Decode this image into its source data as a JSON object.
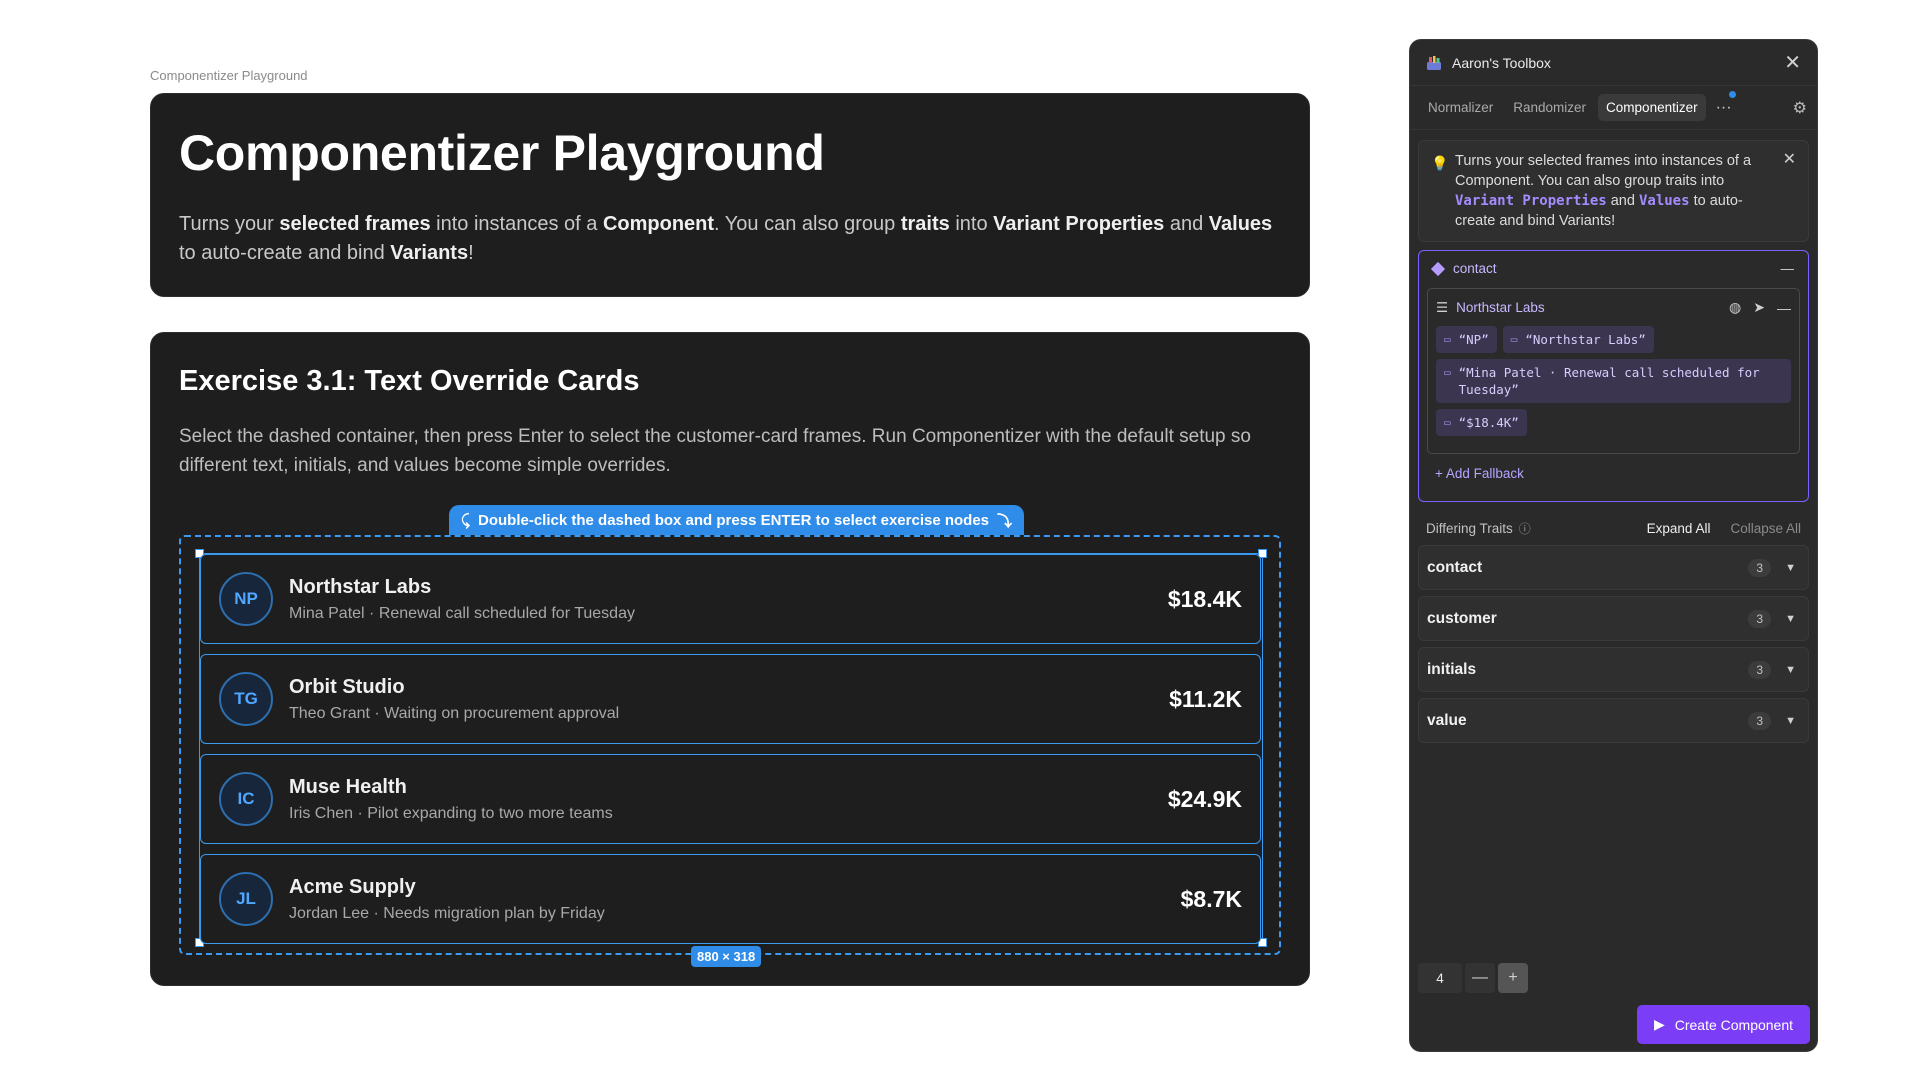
{
  "canvas": {
    "label": "Componentizer Playground"
  },
  "hero": {
    "title": "Componentizer Playground",
    "desc_1": "Turns your ",
    "desc_b1": "selected frames",
    "desc_2": " into instances of a ",
    "desc_b2": "Component",
    "desc_3": ". You can also group ",
    "desc_b3": "traits",
    "desc_4": " into ",
    "desc_b4": "Variant Properties",
    "desc_5": " and ",
    "desc_b5": "Values",
    "desc_6": " to auto-create and bind ",
    "desc_b6": "Variants",
    "desc_7": "!"
  },
  "exercise": {
    "title": "Exercise 3.1: Text Override Cards",
    "description": "Select the dashed container, then press Enter to select the customer-card frames. Run Componentizer with the default setup so different text, initials, and values become simple overrides.",
    "hint": "Double-click the dashed box and press ENTER to select exercise nodes",
    "dimensions": "880 × 318",
    "cards": [
      {
        "initials": "NP",
        "name": "Northstar Labs",
        "sub": "Mina Patel · Renewal call scheduled for Tuesday",
        "value": "$18.4K"
      },
      {
        "initials": "TG",
        "name": "Orbit Studio",
        "sub": "Theo Grant · Waiting on procurement approval",
        "value": "$11.2K"
      },
      {
        "initials": "IC",
        "name": "Muse Health",
        "sub": "Iris Chen · Pilot expanding to two more teams",
        "value": "$24.9K"
      },
      {
        "initials": "JL",
        "name": "Acme Supply",
        "sub": "Jordan Lee · Needs migration plan by Friday",
        "value": "$8.7K"
      }
    ]
  },
  "panel": {
    "title": "Aaron's Toolbox",
    "tabs": [
      "Normalizer",
      "Randomizer",
      "Componentizer"
    ],
    "active_tab": "Componentizer",
    "more": "···",
    "info": {
      "t1": "Turns your selected frames into instances of a Component. You can also group traits into ",
      "code1": "Variant Properties",
      "t2": " and ",
      "code2": "Values",
      "t3": " to auto-create and bind Variants!"
    },
    "group": {
      "name": "contact",
      "sub_name": "Northstar Labs",
      "chips": [
        "“NP”",
        "“Northstar Labs”",
        "“Mina Patel · Renewal call scheduled for Tuesday”",
        "“$18.4K”"
      ],
      "add_fallback": "+ Add Fallback"
    },
    "traits": {
      "label": "Differing Traits",
      "expand_all": "Expand All",
      "collapse_all": "Collapse All",
      "items": [
        {
          "name": "contact",
          "count": "3"
        },
        {
          "name": "customer",
          "count": "3"
        },
        {
          "name": "initials",
          "count": "3"
        },
        {
          "name": "value",
          "count": "3"
        }
      ]
    },
    "stepper_value": "4",
    "create_label": "Create Component",
    "accent": "#7b3df5"
  }
}
